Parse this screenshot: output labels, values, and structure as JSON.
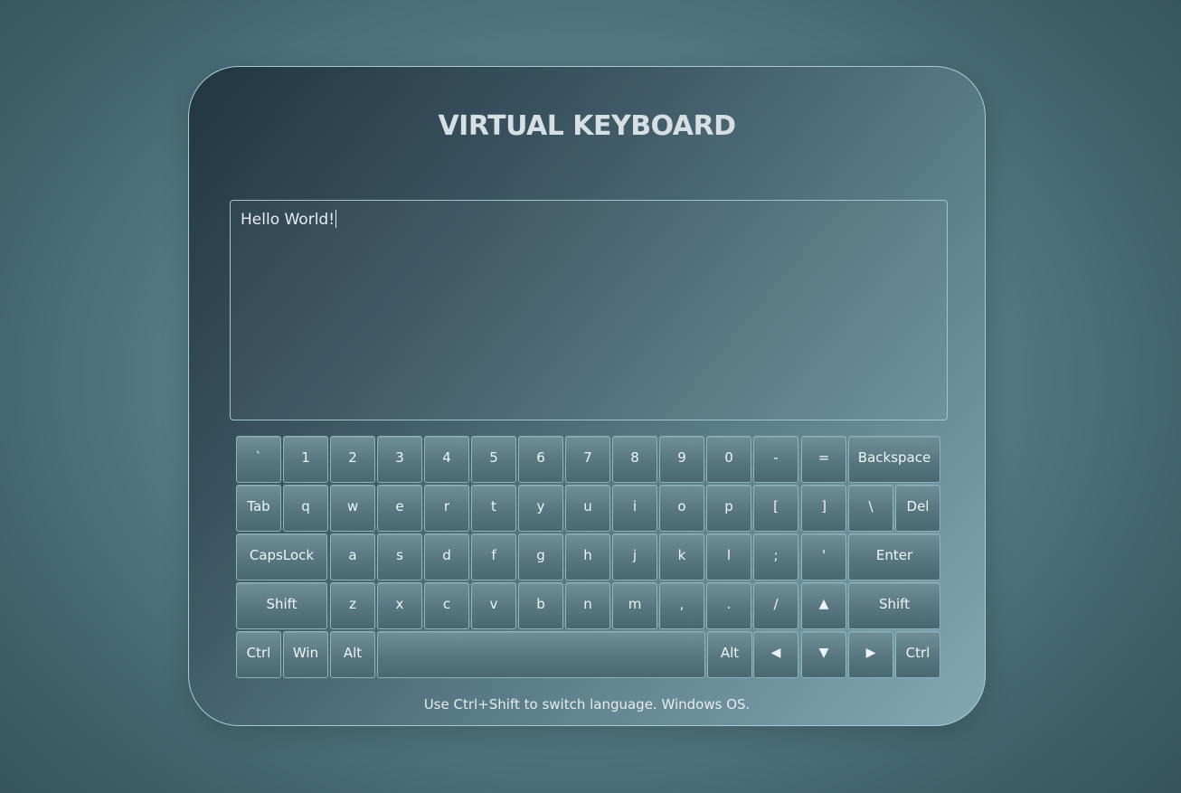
{
  "title": "VIRTUAL KEYBOARD",
  "editor": {
    "value": "Hello World!"
  },
  "keyboard": {
    "rows": [
      [
        {
          "label": "`",
          "name": "key-backtick"
        },
        {
          "label": "1",
          "name": "key-1"
        },
        {
          "label": "2",
          "name": "key-2"
        },
        {
          "label": "3",
          "name": "key-3"
        },
        {
          "label": "4",
          "name": "key-4"
        },
        {
          "label": "5",
          "name": "key-5"
        },
        {
          "label": "6",
          "name": "key-6"
        },
        {
          "label": "7",
          "name": "key-7"
        },
        {
          "label": "8",
          "name": "key-8"
        },
        {
          "label": "9",
          "name": "key-9"
        },
        {
          "label": "0",
          "name": "key-0"
        },
        {
          "label": "-",
          "name": "key-minus"
        },
        {
          "label": "=",
          "name": "key-equals"
        },
        {
          "label": "Backspace",
          "name": "key-backspace"
        }
      ],
      [
        {
          "label": "Tab",
          "name": "key-tab"
        },
        {
          "label": "q",
          "name": "key-q"
        },
        {
          "label": "w",
          "name": "key-w"
        },
        {
          "label": "e",
          "name": "key-e"
        },
        {
          "label": "r",
          "name": "key-r"
        },
        {
          "label": "t",
          "name": "key-t"
        },
        {
          "label": "y",
          "name": "key-y"
        },
        {
          "label": "u",
          "name": "key-u"
        },
        {
          "label": "i",
          "name": "key-i"
        },
        {
          "label": "o",
          "name": "key-o"
        },
        {
          "label": "p",
          "name": "key-p"
        },
        {
          "label": "[",
          "name": "key-open-bracket"
        },
        {
          "label": "]",
          "name": "key-close-bracket"
        },
        {
          "label": "\\",
          "name": "key-backslash"
        },
        {
          "label": "Del",
          "name": "key-del"
        }
      ],
      [
        {
          "label": "CapsLock",
          "name": "key-capslock"
        },
        {
          "label": "a",
          "name": "key-a"
        },
        {
          "label": "s",
          "name": "key-s"
        },
        {
          "label": "d",
          "name": "key-d"
        },
        {
          "label": "f",
          "name": "key-f"
        },
        {
          "label": "g",
          "name": "key-g"
        },
        {
          "label": "h",
          "name": "key-h"
        },
        {
          "label": "j",
          "name": "key-j"
        },
        {
          "label": "k",
          "name": "key-k"
        },
        {
          "label": "l",
          "name": "key-l"
        },
        {
          "label": ";",
          "name": "key-semicolon"
        },
        {
          "label": "'",
          "name": "key-quote"
        },
        {
          "label": "Enter",
          "name": "key-enter"
        }
      ],
      [
        {
          "label": "Shift",
          "name": "key-shift-left"
        },
        {
          "label": "z",
          "name": "key-z"
        },
        {
          "label": "x",
          "name": "key-x"
        },
        {
          "label": "c",
          "name": "key-c"
        },
        {
          "label": "v",
          "name": "key-v"
        },
        {
          "label": "b",
          "name": "key-b"
        },
        {
          "label": "n",
          "name": "key-n"
        },
        {
          "label": "m",
          "name": "key-m"
        },
        {
          "label": ",",
          "name": "key-comma"
        },
        {
          "label": ".",
          "name": "key-period"
        },
        {
          "label": "/",
          "name": "key-slash"
        },
        {
          "label": "▲",
          "name": "key-arrow-up",
          "icon": "arrow-up-icon"
        },
        {
          "label": "Shift",
          "name": "key-shift-right"
        }
      ],
      [
        {
          "label": "Ctrl",
          "name": "key-ctrl-left"
        },
        {
          "label": "Win",
          "name": "key-win"
        },
        {
          "label": "Alt",
          "name": "key-alt-left"
        },
        {
          "label": "",
          "name": "key-space"
        },
        {
          "label": "Alt",
          "name": "key-alt-right"
        },
        {
          "label": "◀",
          "name": "key-arrow-left",
          "icon": "arrow-left-icon"
        },
        {
          "label": "▼",
          "name": "key-arrow-down",
          "icon": "arrow-down-icon"
        },
        {
          "label": "▶",
          "name": "key-arrow-right",
          "icon": "arrow-right-icon"
        },
        {
          "label": "Ctrl",
          "name": "key-ctrl-right"
        }
      ]
    ]
  },
  "footer": {
    "hint": "Use Ctrl+Shift to switch language. Windows OS."
  }
}
